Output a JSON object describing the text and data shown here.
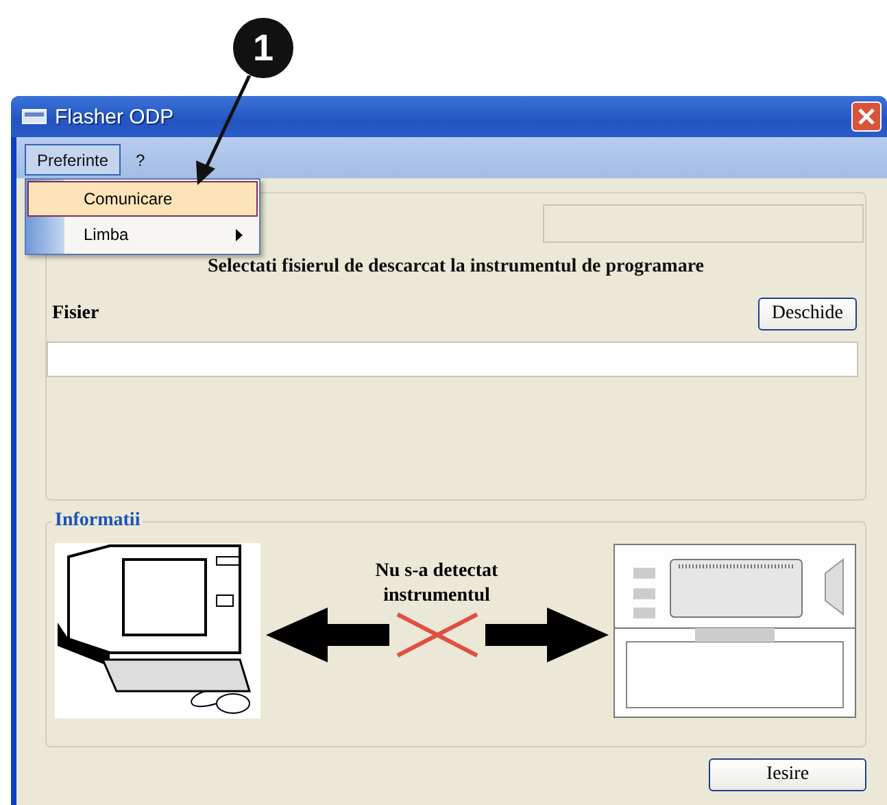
{
  "callout": {
    "number": "1"
  },
  "window": {
    "title": "Flasher ODP"
  },
  "menu_bar": [
    {
      "label": "Preferinte",
      "selected": true
    },
    {
      "label": "?",
      "selected": false
    }
  ],
  "dropdown": {
    "items": [
      {
        "label": "Comunicare",
        "selected": true,
        "submenu": false
      },
      {
        "label": "Limba",
        "selected": false,
        "submenu": true
      }
    ]
  },
  "file_section": {
    "instruction": "Selectati fisierul de descarcat la instrumentul de programare",
    "file_label": "Fisier",
    "open_button": "Deschide"
  },
  "info": {
    "legend": "Informatii",
    "status": "Nu s-a detectat instrumentul"
  },
  "exit_button": "Iesire"
}
